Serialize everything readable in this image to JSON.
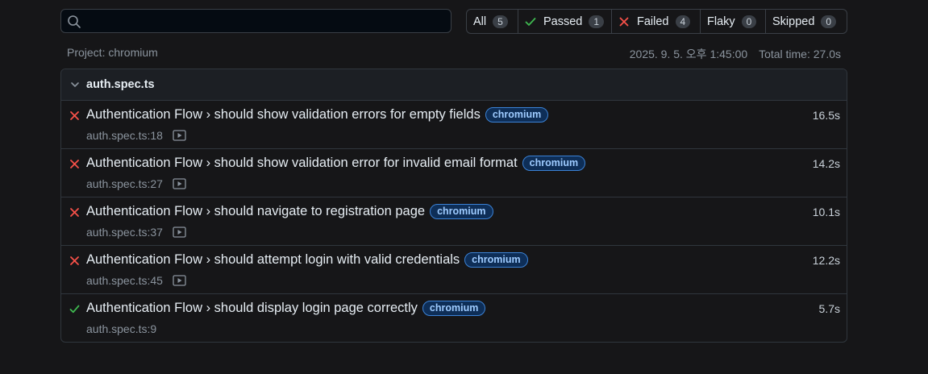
{
  "search": {
    "placeholder": "",
    "value": ""
  },
  "filters": [
    {
      "label": "All",
      "count": "5",
      "icon": ""
    },
    {
      "label": "Passed",
      "count": "1",
      "icon": "check-icon"
    },
    {
      "label": "Failed",
      "count": "4",
      "icon": "cross-icon"
    },
    {
      "label": "Flaky",
      "count": "0",
      "icon": ""
    },
    {
      "label": "Skipped",
      "count": "0",
      "icon": ""
    }
  ],
  "meta": {
    "project": "Project: chromium",
    "datetime": "2025. 9. 5. 오후 1:45:00",
    "total_time": "Total time: 27.0s"
  },
  "file": {
    "name": "auth.spec.ts",
    "tests": [
      {
        "status": "failed",
        "title": "Authentication Flow › should show validation errors for empty fields",
        "tag": "chromium",
        "location": "auth.spec.ts:18",
        "has_video": true,
        "duration": "16.5s"
      },
      {
        "status": "failed",
        "title": "Authentication Flow › should show validation error for invalid email format",
        "tag": "chromium",
        "location": "auth.spec.ts:27",
        "has_video": true,
        "duration": "14.2s"
      },
      {
        "status": "failed",
        "title": "Authentication Flow › should navigate to registration page",
        "tag": "chromium",
        "location": "auth.spec.ts:37",
        "has_video": true,
        "duration": "10.1s"
      },
      {
        "status": "failed",
        "title": "Authentication Flow › should attempt login with valid credentials",
        "tag": "chromium",
        "location": "auth.spec.ts:45",
        "has_video": true,
        "duration": "12.2s"
      },
      {
        "status": "passed",
        "title": "Authentication Flow › should display login page correctly",
        "tag": "chromium",
        "location": "auth.spec.ts:9",
        "has_video": false,
        "duration": "5.7s"
      }
    ]
  },
  "colors": {
    "failed": "#f85149",
    "passed": "#3fb950",
    "tag_text": "#9ecbff",
    "tag_bg": "#0e2e57"
  }
}
